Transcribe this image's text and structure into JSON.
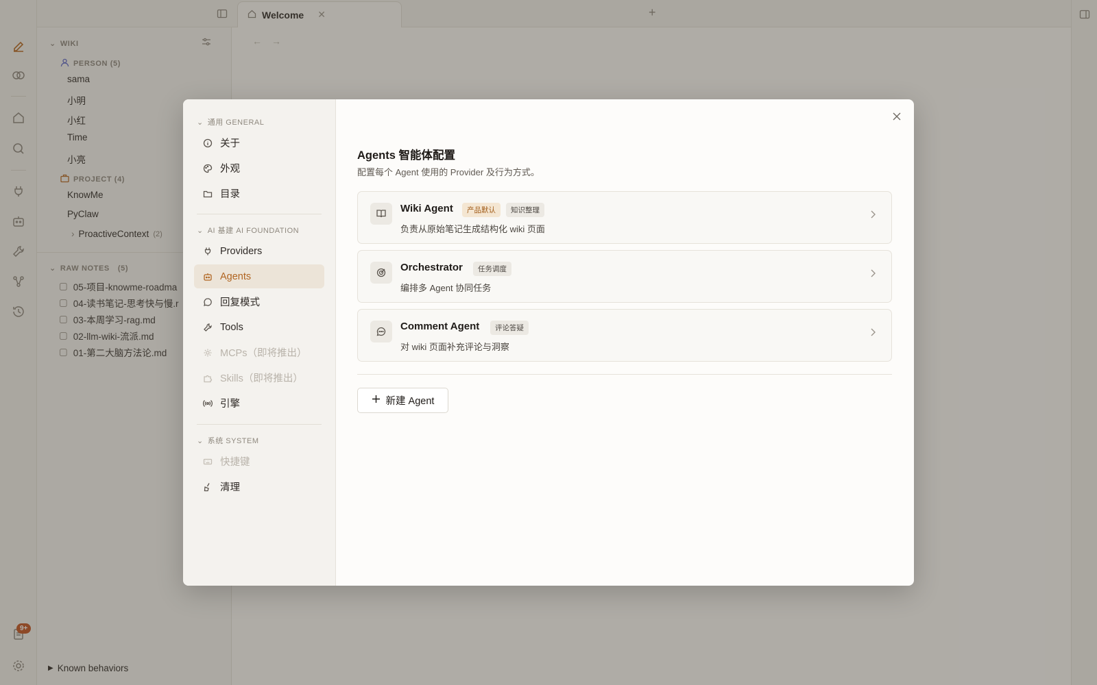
{
  "tabs": {
    "active_tab": "Welcome"
  },
  "sidebar": {
    "wiki_header": "WIKI",
    "person_header": "PERSON (5)",
    "persons": [
      "sama",
      "小明",
      "小红",
      "Time",
      "小亮"
    ],
    "project_header": "PROJECT (4)",
    "projects": [
      "KnowMe",
      "PyClaw"
    ],
    "subproject": {
      "name": "ProactiveContext",
      "count": "(2)"
    },
    "raw_header": "RAW NOTES",
    "raw_count": "(5)",
    "raw_files": [
      "05-项目-knowme-roadma",
      "04-读书笔记-思考快与慢.r",
      "03-本周学习-rag.md",
      "02-llm-wiki-流派.md",
      "01-第二大脑方法论.md"
    ],
    "footer": "Known behaviors"
  },
  "iconbar": {
    "badge": "9+"
  },
  "settings": {
    "groups": {
      "general": "通用 GENERAL",
      "ai": "AI 基建 AI FOUNDATION",
      "system": "系统 SYSTEM"
    },
    "nav": {
      "about": "关于",
      "appearance": "外观",
      "directory": "目录",
      "providers": "Providers",
      "agents": "Agents",
      "reply_mode": "回复模式",
      "tools": "Tools",
      "mcps": "MCPs（即将推出）",
      "skills": "Skills（即将推出）",
      "engine": "引擎",
      "shortcuts": "快捷键",
      "cleanup": "清理"
    },
    "content": {
      "title": "Agents 智能体配置",
      "subtitle": "配置每个 Agent 使用的 Provider 及行为方式。",
      "agents": [
        {
          "name": "Wiki Agent",
          "tags": [
            "产品默认",
            "知识整理"
          ],
          "desc": "负责从原始笔记生成结构化 wiki 页面",
          "icon": "book-icon"
        },
        {
          "name": "Orchestrator",
          "tags": [
            "任务调度"
          ],
          "desc": "编排多 Agent 协同任务",
          "icon": "target-icon"
        },
        {
          "name": "Comment Agent",
          "tags": [
            "评论答疑"
          ],
          "desc": "对 wiki 页面补充评论与洞察",
          "icon": "comment-icon"
        }
      ],
      "new_button": "新建 Agent"
    }
  },
  "colors": {
    "accent": "#b06420",
    "overlay": "#464038"
  }
}
